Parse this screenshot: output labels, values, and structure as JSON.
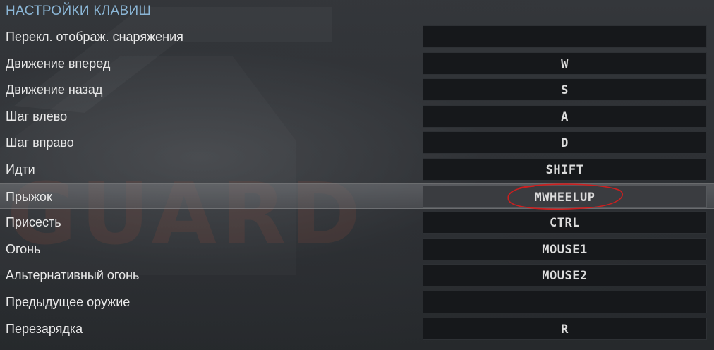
{
  "header": {
    "title": "НАСТРОЙКИ КЛАВИШ"
  },
  "watermark": {
    "text": "GUARD"
  },
  "bindings": [
    {
      "label": "Перекл. отображ. снаряжения",
      "key": ""
    },
    {
      "label": "Движение вперед",
      "key": "W"
    },
    {
      "label": "Движение назад",
      "key": "S"
    },
    {
      "label": "Шаг влево",
      "key": "A"
    },
    {
      "label": "Шаг вправо",
      "key": "D"
    },
    {
      "label": "Идти",
      "key": "SHIFT"
    },
    {
      "label": "Прыжок",
      "key": "MWHEELUP"
    },
    {
      "label": "Присесть",
      "key": "CTRL"
    },
    {
      "label": "Огонь",
      "key": "MOUSE1"
    },
    {
      "label": "Альтернативный огонь",
      "key": "MOUSE2"
    },
    {
      "label": "Предыдущее оружие",
      "key": ""
    },
    {
      "label": "Перезарядка",
      "key": "R"
    }
  ],
  "selected_binding": "Прыжок",
  "colors": {
    "header_text": "#8bb6d6",
    "annotation_circle": "#cc1f1f",
    "key_field_bg": "#16181b"
  }
}
